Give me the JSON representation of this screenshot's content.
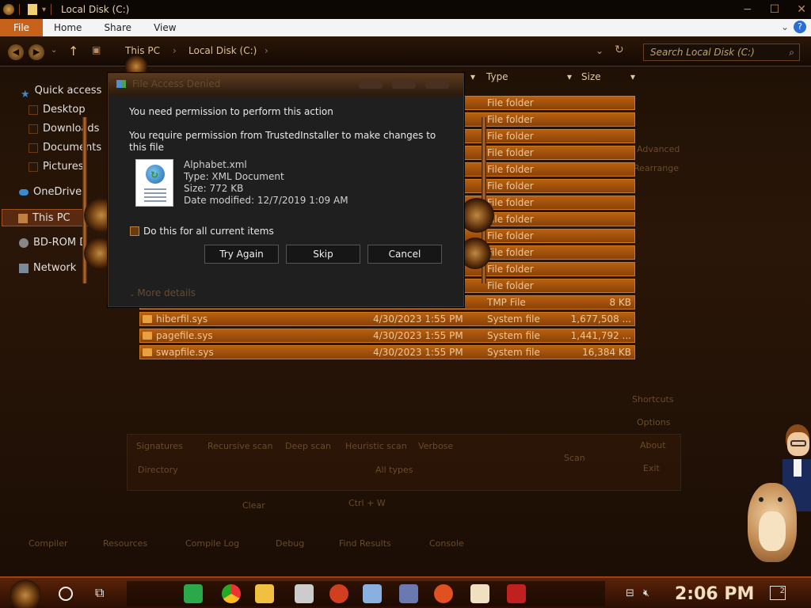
{
  "window": {
    "title": "Local Disk (C:)"
  },
  "ribbon": {
    "tabs": [
      "File",
      "Home",
      "Share",
      "View"
    ]
  },
  "address": {
    "crumbs": [
      "This PC",
      "Local Disk (C:)"
    ],
    "search_placeholder": "Search Local Disk (C:)"
  },
  "nav": {
    "items": [
      {
        "label": "Quick access",
        "icon": "star-icon"
      },
      {
        "label": "Desktop",
        "icon": "desktop-icon"
      },
      {
        "label": "Downloads",
        "icon": "download-icon"
      },
      {
        "label": "Documents",
        "icon": "documents-icon"
      },
      {
        "label": "Pictures",
        "icon": "pictures-icon"
      },
      {
        "label": "OneDrive",
        "icon": "cloud-icon"
      },
      {
        "label": "This PC",
        "icon": "computer-icon"
      },
      {
        "label": "BD-ROM D",
        "icon": "disc-icon"
      },
      {
        "label": "Network",
        "icon": "network-icon"
      }
    ],
    "selected": "This PC"
  },
  "columns": {
    "type": "Type",
    "size": "Size"
  },
  "files": [
    {
      "name": "",
      "date": "",
      "type": "File folder",
      "size": ""
    },
    {
      "name": "",
      "date": "",
      "type": "File folder",
      "size": ""
    },
    {
      "name": "",
      "date": "",
      "type": "File folder",
      "size": ""
    },
    {
      "name": "",
      "date": "",
      "type": "File folder",
      "size": ""
    },
    {
      "name": "",
      "date": "",
      "type": "File folder",
      "size": ""
    },
    {
      "name": "",
      "date": "",
      "type": "File folder",
      "size": ""
    },
    {
      "name": "",
      "date": "",
      "type": "File folder",
      "size": ""
    },
    {
      "name": "",
      "date": "",
      "type": "File folder",
      "size": ""
    },
    {
      "name": "",
      "date": "",
      "type": "File folder",
      "size": ""
    },
    {
      "name": "",
      "date": "",
      "type": "File folder",
      "size": ""
    },
    {
      "name": "",
      "date": "",
      "type": "File folder",
      "size": ""
    },
    {
      "name": "",
      "date": "",
      "type": "File folder",
      "size": ""
    },
    {
      "name": "",
      "date": "",
      "type": "TMP File",
      "size": "8 KB"
    },
    {
      "name": "hiberfil.sys",
      "date": "4/30/2023 1:55 PM",
      "type": "System file",
      "size": "1,677,508 ..."
    },
    {
      "name": "pagefile.sys",
      "date": "4/30/2023 1:55 PM",
      "type": "System file",
      "size": "1,441,792 ..."
    },
    {
      "name": "swapfile.sys",
      "date": "4/30/2023 1:55 PM",
      "type": "System file",
      "size": "16,384 KB"
    }
  ],
  "dialog": {
    "title": "File Access Denied",
    "heading": "You need permission to perform this action",
    "message": "You require permission from TrustedInstaller to make changes to this file",
    "file": {
      "name": "Alphabet.xml",
      "type": "Type: XML Document",
      "size": "Size: 772 KB",
      "modified": "Date modified: 12/7/2019 1:09 AM"
    },
    "checkbox_label": "Do this for all current items",
    "buttons": {
      "try_again": "Try Again",
      "skip": "Skip",
      "cancel": "Cancel"
    },
    "more_details": "More details"
  },
  "background_app": {
    "labels": [
      "Advanced",
      "Rearrange",
      "Shortcuts",
      "Options",
      "About",
      "Exit",
      "Scan",
      "Signatures",
      "Recursive scan",
      "Deep scan",
      "Heuristic scan",
      "Verbose",
      "Directory",
      "All types",
      "Clear",
      "Ctrl + W",
      "Compiler",
      "Resources",
      "Compile Log",
      "Debug",
      "Find Results",
      "Console"
    ]
  },
  "taskbar": {
    "clock": "2:06 PM",
    "notification_count": "2",
    "apps": [
      "start-gear-icon",
      "cortana-icon",
      "task-view-icon",
      "sheets-icon",
      "chrome-icon",
      "file-explorer-icon",
      "unity-icon",
      "app-icon",
      "notepad-icon",
      "virtualbox-icon",
      "app2-icon",
      "app3-icon",
      "devcpp-icon"
    ]
  },
  "colors": {
    "accent": "#c8621a",
    "row_fill": "#a85412",
    "dialog_bg": "#1f1f1f"
  }
}
